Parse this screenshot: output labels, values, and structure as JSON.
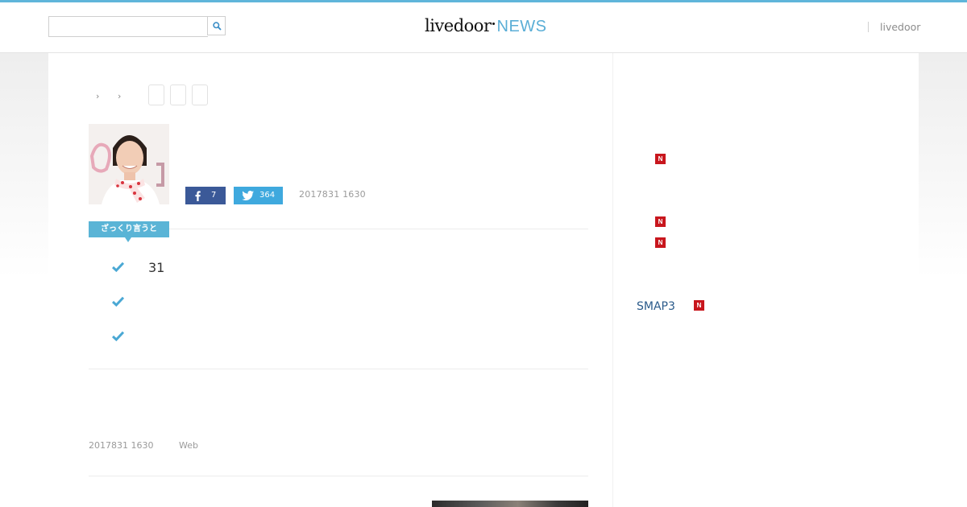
{
  "header": {
    "search": {
      "placeholder": "",
      "value": ""
    },
    "logo": {
      "main": "livedoor",
      "accent": "NEWS"
    },
    "right_link": "livedoor"
  },
  "breadcrumb": {
    "chevrons": [
      "›",
      "›"
    ],
    "boxes": 3
  },
  "article": {
    "share": {
      "facebook_count": "7",
      "twitter_count": "364"
    },
    "published": "2017831 1630",
    "summary_label": "ざっくり言うと",
    "points": [
      "31",
      "",
      ""
    ],
    "meta": {
      "date": "2017831 1630",
      "source": "Web"
    }
  },
  "sidebar": {
    "new_badge": "N",
    "items": [
      {
        "label": "",
        "is_new": true
      },
      {
        "label": "",
        "is_new": true
      },
      {
        "label": "",
        "is_new": true
      },
      {
        "label": "SMAP3",
        "is_new": true
      }
    ]
  },
  "colors": {
    "accent": "#5ab4d6",
    "top_bar": "#5fb5da",
    "facebook": "#3b5998",
    "twitter": "#3fa9de",
    "new_badge": "#c8161d",
    "link": "#2a5a8a"
  }
}
